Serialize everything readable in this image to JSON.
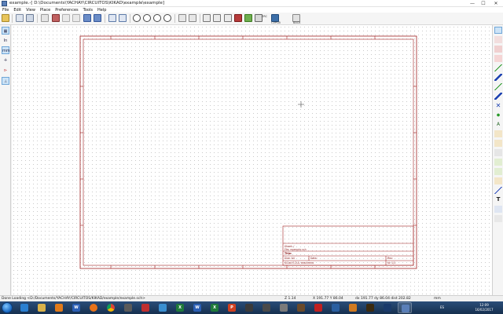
{
  "window": {
    "title": "example.-[ D:\\Documents\\YACHAY\\CIRCUITOS\\KIKAD\\example\\example]",
    "minimize": "—",
    "maximize": "☐",
    "close": "✕"
  },
  "menu": [
    "File",
    "Edit",
    "View",
    "Place",
    "Preferences",
    "Tools",
    "Help"
  ],
  "toolbar": {
    "labels": {
      "erc": "ERC",
      "cvpcb": "CVPCB",
      "back": "BACK"
    }
  },
  "left_toolbar": {
    "items": [
      {
        "name": "grid-toggle-icon",
        "glyph": "▦"
      },
      {
        "name": "units-inch-icon",
        "glyph": "In"
      },
      {
        "name": "units-mm-icon",
        "glyph": "mm"
      },
      {
        "name": "cursor-shape-icon",
        "glyph": "✛"
      },
      {
        "name": "hidden-pins-icon",
        "glyph": "⊳"
      },
      {
        "name": "bus-wire-angle-icon",
        "glyph": "⊥"
      }
    ]
  },
  "title_block": {
    "sheet": "Sheet: /",
    "file": "File: example.sch",
    "title": "Title:",
    "size": "Size: A4",
    "date": "Date:",
    "rev": "Rev:",
    "kicad": "KiCad E.D.A. eeschema",
    "id": "Id: 1/1"
  },
  "status": {
    "message": "Done Loading <D:/Documents/YACHAY/CIRCUITOS/KIKAD/example/example.sch>",
    "zoom": "Z 1.14",
    "xy": "X 191.77  Y 86.04",
    "dxdy": "dx 191.77  dy 86.04  dist 202.82",
    "units": "mm"
  },
  "taskbar": {
    "time": "12:09",
    "date": "16/02/2017",
    "lang": "ES"
  }
}
